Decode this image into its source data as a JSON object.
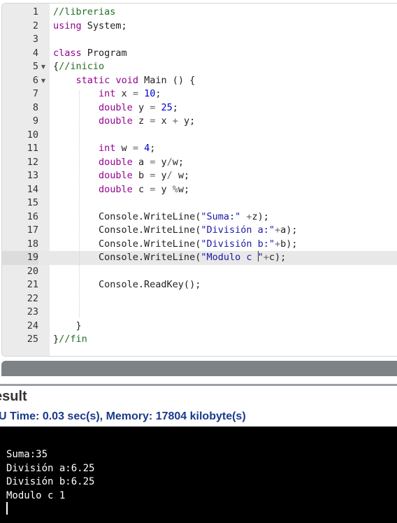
{
  "editor": {
    "active_line": 19,
    "lines": [
      {
        "n": "1",
        "fold": "",
        "tokens": [
          {
            "t": "//librerias",
            "c": "comment"
          }
        ]
      },
      {
        "n": "2",
        "fold": "",
        "tokens": [
          {
            "t": "using",
            "c": "keyword"
          },
          {
            "t": " System;",
            "c": "ident"
          }
        ]
      },
      {
        "n": "3",
        "fold": "",
        "tokens": []
      },
      {
        "n": "4",
        "fold": "",
        "tokens": [
          {
            "t": "class",
            "c": "keyword"
          },
          {
            "t": " Program",
            "c": "ident"
          }
        ]
      },
      {
        "n": "5",
        "fold": "▼",
        "tokens": [
          {
            "t": "{",
            "c": "ident"
          },
          {
            "t": "//inicio",
            "c": "comment"
          }
        ]
      },
      {
        "n": "6",
        "fold": "▼",
        "tokens": [
          {
            "t": "    ",
            "c": "ident"
          },
          {
            "t": "static",
            "c": "keyword"
          },
          {
            "t": " ",
            "c": "ident"
          },
          {
            "t": "void",
            "c": "keyword"
          },
          {
            "t": " Main () {",
            "c": "ident"
          }
        ]
      },
      {
        "n": "7",
        "fold": "",
        "tokens": [
          {
            "t": "        ",
            "c": "ident"
          },
          {
            "t": "int",
            "c": "type"
          },
          {
            "t": " x ",
            "c": "ident"
          },
          {
            "t": "=",
            "c": "op"
          },
          {
            "t": " ",
            "c": "ident"
          },
          {
            "t": "10",
            "c": "number"
          },
          {
            "t": ";",
            "c": "ident"
          }
        ]
      },
      {
        "n": "8",
        "fold": "",
        "tokens": [
          {
            "t": "        ",
            "c": "ident"
          },
          {
            "t": "double",
            "c": "type"
          },
          {
            "t": " y ",
            "c": "ident"
          },
          {
            "t": "=",
            "c": "op"
          },
          {
            "t": " ",
            "c": "ident"
          },
          {
            "t": "25",
            "c": "number"
          },
          {
            "t": ";",
            "c": "ident"
          }
        ]
      },
      {
        "n": "9",
        "fold": "",
        "tokens": [
          {
            "t": "        ",
            "c": "ident"
          },
          {
            "t": "double",
            "c": "type"
          },
          {
            "t": " z ",
            "c": "ident"
          },
          {
            "t": "=",
            "c": "op"
          },
          {
            "t": " x ",
            "c": "ident"
          },
          {
            "t": "+",
            "c": "op"
          },
          {
            "t": " y;",
            "c": "ident"
          }
        ]
      },
      {
        "n": "10",
        "fold": "",
        "tokens": []
      },
      {
        "n": "11",
        "fold": "",
        "tokens": [
          {
            "t": "        ",
            "c": "ident"
          },
          {
            "t": "int",
            "c": "type"
          },
          {
            "t": " w ",
            "c": "ident"
          },
          {
            "t": "=",
            "c": "op"
          },
          {
            "t": " ",
            "c": "ident"
          },
          {
            "t": "4",
            "c": "number"
          },
          {
            "t": ";",
            "c": "ident"
          }
        ]
      },
      {
        "n": "12",
        "fold": "",
        "tokens": [
          {
            "t": "        ",
            "c": "ident"
          },
          {
            "t": "double",
            "c": "type"
          },
          {
            "t": " a ",
            "c": "ident"
          },
          {
            "t": "=",
            "c": "op"
          },
          {
            "t": " y",
            "c": "ident"
          },
          {
            "t": "/",
            "c": "op"
          },
          {
            "t": "w;",
            "c": "ident"
          }
        ]
      },
      {
        "n": "13",
        "fold": "",
        "tokens": [
          {
            "t": "        ",
            "c": "ident"
          },
          {
            "t": "double",
            "c": "type"
          },
          {
            "t": " b ",
            "c": "ident"
          },
          {
            "t": "=",
            "c": "op"
          },
          {
            "t": " y",
            "c": "ident"
          },
          {
            "t": "/",
            "c": "op"
          },
          {
            "t": " w;",
            "c": "ident"
          }
        ]
      },
      {
        "n": "14",
        "fold": "",
        "tokens": [
          {
            "t": "        ",
            "c": "ident"
          },
          {
            "t": "double",
            "c": "type"
          },
          {
            "t": " c ",
            "c": "ident"
          },
          {
            "t": "=",
            "c": "op"
          },
          {
            "t": " y ",
            "c": "ident"
          },
          {
            "t": "%",
            "c": "op"
          },
          {
            "t": "w;",
            "c": "ident"
          }
        ]
      },
      {
        "n": "15",
        "fold": "",
        "tokens": []
      },
      {
        "n": "16",
        "fold": "",
        "tokens": [
          {
            "t": "        Console.WriteLine(",
            "c": "ident"
          },
          {
            "t": "\"Suma:\"",
            "c": "string"
          },
          {
            "t": " ",
            "c": "ident"
          },
          {
            "t": "+",
            "c": "op"
          },
          {
            "t": "z);",
            "c": "ident"
          }
        ]
      },
      {
        "n": "17",
        "fold": "",
        "tokens": [
          {
            "t": "        Console.WriteLine(",
            "c": "ident"
          },
          {
            "t": "\"División a:\"",
            "c": "string"
          },
          {
            "t": "+",
            "c": "op"
          },
          {
            "t": "a);",
            "c": "ident"
          }
        ]
      },
      {
        "n": "18",
        "fold": "",
        "tokens": [
          {
            "t": "        Console.WriteLine(",
            "c": "ident"
          },
          {
            "t": "\"División b:\"",
            "c": "string"
          },
          {
            "t": "+",
            "c": "op"
          },
          {
            "t": "b);",
            "c": "ident"
          }
        ]
      },
      {
        "n": "19",
        "fold": "",
        "tokens": [
          {
            "t": "        Console.WriteLine(",
            "c": "ident"
          },
          {
            "t": "\"Modulo c ",
            "c": "string"
          },
          {
            "t": "",
            "c": "cursor"
          },
          {
            "t": "\"",
            "c": "string"
          },
          {
            "t": "+",
            "c": "op"
          },
          {
            "t": "c);",
            "c": "ident"
          }
        ]
      },
      {
        "n": "20",
        "fold": "",
        "tokens": []
      },
      {
        "n": "21",
        "fold": "",
        "tokens": [
          {
            "t": "        Console.ReadKey();",
            "c": "ident"
          }
        ]
      },
      {
        "n": "22",
        "fold": "",
        "tokens": []
      },
      {
        "n": "23",
        "fold": "",
        "tokens": []
      },
      {
        "n": "24",
        "fold": "",
        "tokens": [
          {
            "t": "    }",
            "c": "ident"
          }
        ]
      },
      {
        "n": "25",
        "fold": "",
        "tokens": [
          {
            "t": "}",
            "c": "ident"
          },
          {
            "t": "//fin",
            "c": "comment"
          }
        ]
      }
    ]
  },
  "result": {
    "title": "esult",
    "stats_prefix": "U Time: ",
    "time": "0.03 sec(s)",
    "stats_mid": ", Memory: ",
    "memory": "17804 kilobyte(s)"
  },
  "console": {
    "lines": [
      "Suma:35",
      "División a:6.25",
      "División b:6.25",
      "Modulo c 1"
    ]
  },
  "colors": {
    "comment": "#236e24",
    "keyword": "#93008f",
    "number": "#0000cd",
    "string": "#1a1aa6",
    "console_bg": "#000000"
  }
}
